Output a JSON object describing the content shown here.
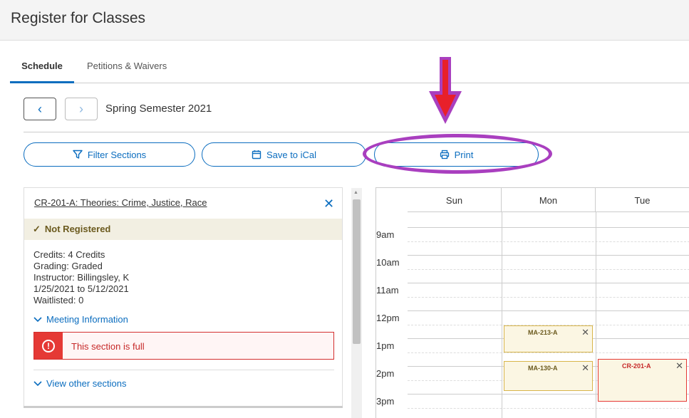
{
  "header": {
    "title": "Register for Classes"
  },
  "tabs": [
    {
      "label": "Schedule",
      "active": true
    },
    {
      "label": "Petitions & Waivers",
      "active": false
    }
  ],
  "nav": {
    "prev": "‹",
    "next": "›",
    "semester": "Spring Semester 2021"
  },
  "actions": {
    "filter_label": "Filter Sections",
    "ical_label": "Save to iCal",
    "print_label": "Print"
  },
  "section": {
    "title": "CR-201-A: Theories: Crime, Justice, Race",
    "status": "Not Registered",
    "credits": "Credits: 4 Credits",
    "grading": "Grading: Graded",
    "instructor": "Instructor: Billingsley, K",
    "dates": "1/25/2021 to 5/12/2021",
    "waitlisted": "Waitlisted:  0",
    "meeting_info": "Meeting Information",
    "alert": "This section is full",
    "other_sections": "View other sections"
  },
  "calendar": {
    "days": [
      "Sun",
      "Mon",
      "Tue"
    ],
    "hours": [
      "9am",
      "10am",
      "11am",
      "12pm",
      "1pm",
      "2pm",
      "3pm"
    ],
    "events": [
      {
        "code": "MA-213-A",
        "status": "scheduled"
      },
      {
        "code": "MA-130-A",
        "status": "scheduled"
      },
      {
        "code": "CR-201-A",
        "status": "full"
      }
    ]
  },
  "colors": {
    "accent": "#0b6dbf",
    "annotation_purple": "#a93fbf",
    "annotation_red": "#e8202a",
    "error_red": "#e53935",
    "status_bg": "#f2efe2"
  }
}
